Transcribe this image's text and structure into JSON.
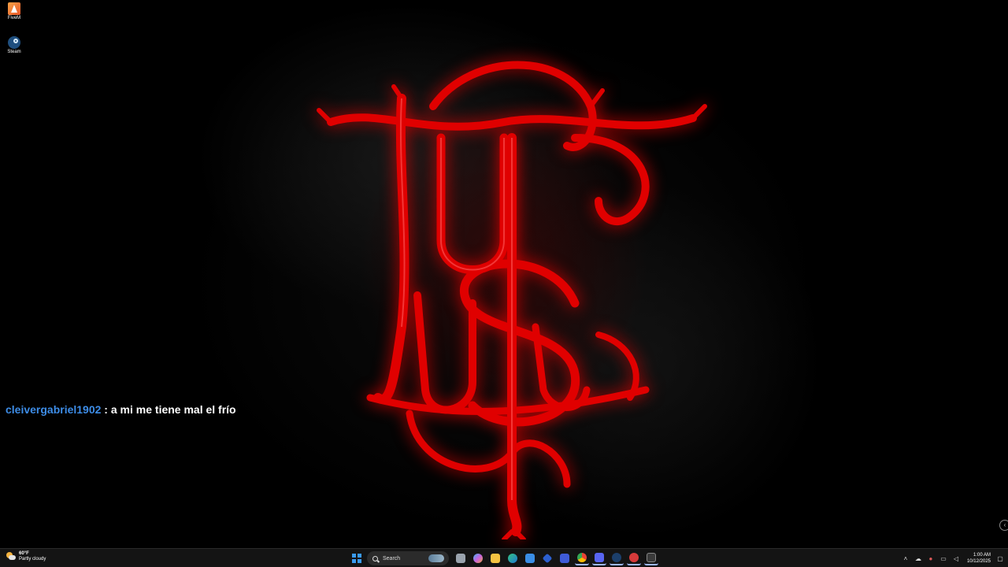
{
  "desktop": {
    "icons": [
      {
        "label": "FiveM"
      },
      {
        "label": "Steam"
      }
    ]
  },
  "chat": {
    "username": "cleivergabriel1902",
    "separator": " : ",
    "message": "a mi me tiene mal el frío",
    "username_color": "#3d8ce6",
    "message_color": "#ffffff"
  },
  "wallpaper": {
    "accent_color": "#e00000"
  },
  "taskbar": {
    "weather": {
      "temp": "60°F",
      "condition": "Partly cloudy"
    },
    "search_label": "Search",
    "apps": [
      "start-icon",
      "search",
      "file-explorer-icon",
      "copilot-icon",
      "folder-icon",
      "edge-icon",
      "store-icon",
      "app-icon",
      "app-icon",
      "chrome-icon",
      "discord-icon",
      "steam-icon",
      "app-icon",
      "terminal-icon"
    ],
    "clock": {
      "time": "1:00 AM",
      "date": "10/12/2025"
    }
  }
}
